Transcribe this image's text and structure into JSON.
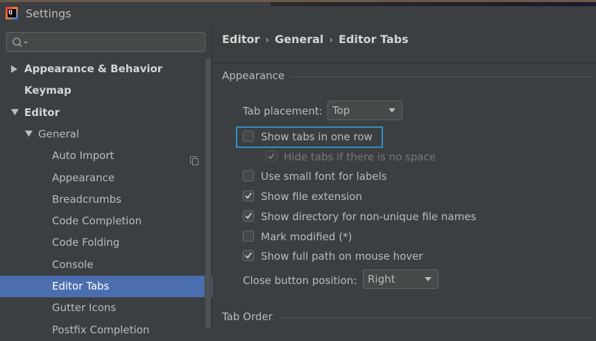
{
  "window": {
    "title": "Settings"
  },
  "search": {
    "placeholder": ""
  },
  "tree": [
    {
      "label": "Appearance & Behavior",
      "bold": true,
      "arrow": "right",
      "indent": 0
    },
    {
      "label": "Keymap",
      "bold": true,
      "arrow": "none",
      "indent": 0
    },
    {
      "label": "Editor",
      "bold": true,
      "arrow": "down",
      "indent": 0
    },
    {
      "label": "General",
      "bold": false,
      "arrow": "down",
      "indent": 1
    },
    {
      "label": "Auto Import",
      "bold": false,
      "arrow": "none",
      "indent": 2,
      "copy_icon": true
    },
    {
      "label": "Appearance",
      "bold": false,
      "arrow": "none",
      "indent": 2
    },
    {
      "label": "Breadcrumbs",
      "bold": false,
      "arrow": "none",
      "indent": 2
    },
    {
      "label": "Code Completion",
      "bold": false,
      "arrow": "none",
      "indent": 2
    },
    {
      "label": "Code Folding",
      "bold": false,
      "arrow": "none",
      "indent": 2
    },
    {
      "label": "Console",
      "bold": false,
      "arrow": "none",
      "indent": 2
    },
    {
      "label": "Editor Tabs",
      "bold": false,
      "arrow": "none",
      "indent": 2,
      "selected": true
    },
    {
      "label": "Gutter Icons",
      "bold": false,
      "arrow": "none",
      "indent": 2
    },
    {
      "label": "Postfix Completion",
      "bold": false,
      "arrow": "none",
      "indent": 2
    }
  ],
  "breadcrumb": {
    "part1": "Editor",
    "part2": "General",
    "part3": "Editor Tabs",
    "sep": "›"
  },
  "appearance_group": {
    "title": "Appearance"
  },
  "tab_placement": {
    "label": "Tab placement:",
    "value": "Top"
  },
  "checkboxes": [
    {
      "label": "Show tabs in one row",
      "checked": false,
      "disabled": false
    },
    {
      "label": "Hide tabs if there is no space",
      "checked": true,
      "disabled": true
    },
    {
      "label": "Use small font for labels",
      "checked": false,
      "disabled": false
    },
    {
      "label": "Show file extension",
      "checked": true,
      "disabled": false
    },
    {
      "label": "Show directory for non-unique file names",
      "checked": true,
      "disabled": false
    },
    {
      "label": "Mark modified (*)",
      "checked": false,
      "disabled": false
    },
    {
      "label": "Show full path on mouse hover",
      "checked": true,
      "disabled": false
    }
  ],
  "close_button": {
    "label": "Close button position:",
    "value": "Right"
  },
  "tab_order_group": {
    "title": "Tab Order"
  },
  "colors": {
    "selection": "#4b6eaf",
    "focus": "#3592c4",
    "background": "#3c3f41"
  }
}
